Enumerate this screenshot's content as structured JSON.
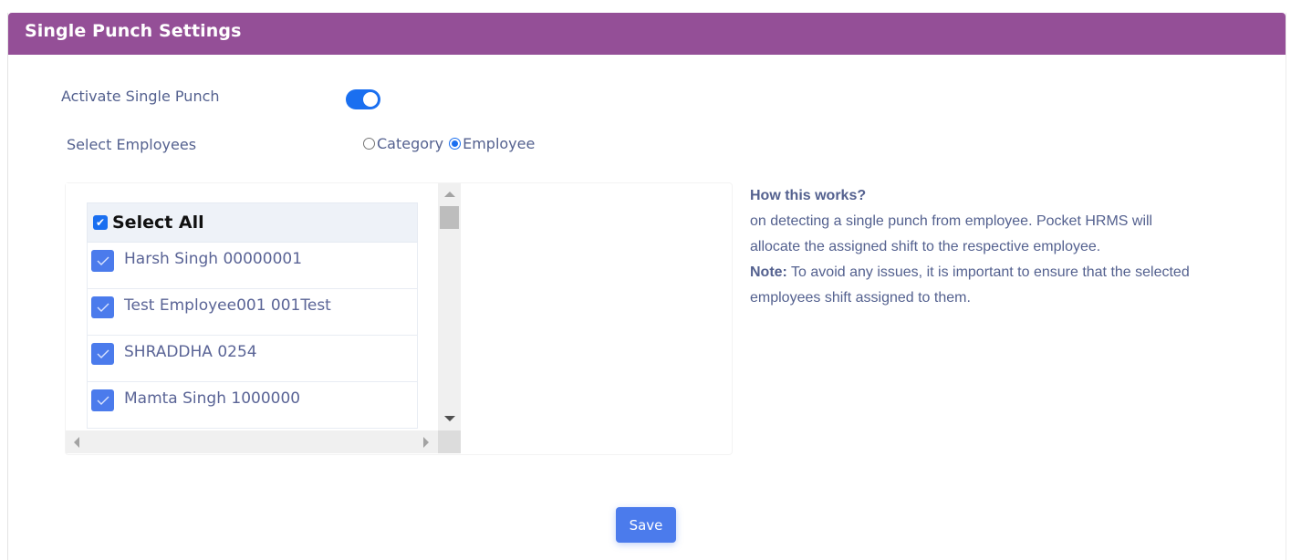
{
  "header": {
    "title": "Single Punch Settings"
  },
  "settings": {
    "activate_label": "Activate Single Punch",
    "activate_on": true,
    "select_employees_label": "Select Employees",
    "radio_options": [
      {
        "label": "Category",
        "checked": false
      },
      {
        "label": "Employee",
        "checked": true
      }
    ]
  },
  "employee_list": {
    "select_all_label": "Select All",
    "select_all_checked": true,
    "items": [
      {
        "name": "Harsh Singh 00000001",
        "checked": true
      },
      {
        "name": "Test Employee001 001Test",
        "checked": true
      },
      {
        "name": "SHRADDHA 0254",
        "checked": true
      },
      {
        "name": "Mamta Singh 1000000",
        "checked": true
      }
    ]
  },
  "info": {
    "heading": "How this works?",
    "line1": "on detecting a single punch from employee. Pocket HRMS will",
    "line2": "allocate the assigned shift to the respective employee.",
    "note_label": "Note:",
    "note_text": " To avoid any issues, it is important to ensure that the selected",
    "note_line2": "employees shift assigned to them."
  },
  "actions": {
    "save_label": "Save"
  },
  "colors": {
    "header": "#944f97",
    "accent": "#1a6ff0",
    "button": "#4b7bec",
    "text": "#54618f"
  }
}
